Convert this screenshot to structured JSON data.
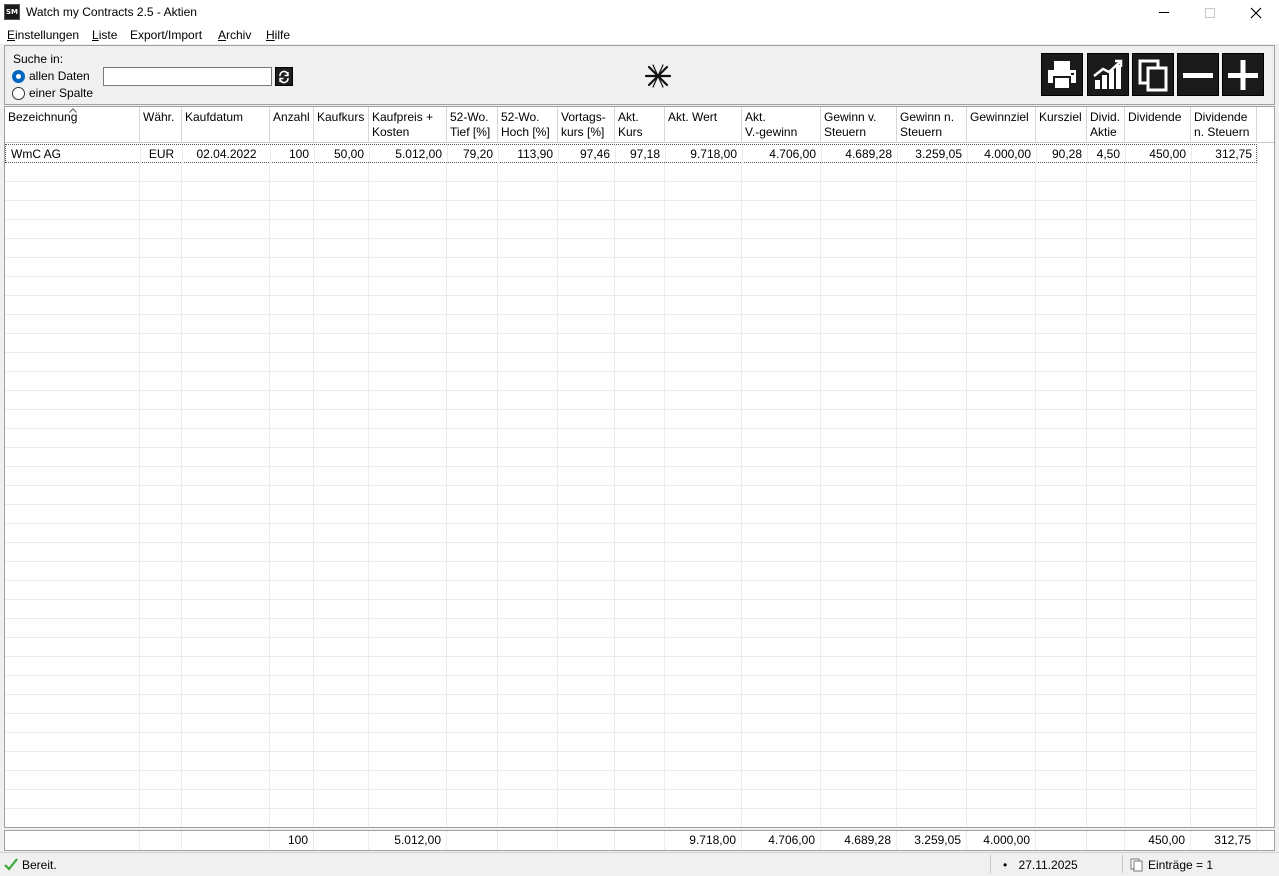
{
  "window": {
    "icon_text": "SM",
    "title": "Watch my Contracts 2.5 - Aktien"
  },
  "menu": [
    {
      "label": "Einstellungen",
      "accel": "E",
      "rest": "instellungen"
    },
    {
      "label": "Liste",
      "accel": "L",
      "rest": "iste"
    },
    {
      "label": "Export/Import",
      "accel": "",
      "rest": "Export/Import"
    },
    {
      "label": "Archiv",
      "accel": "A",
      "rest": "rchiv"
    },
    {
      "label": "Hilfe",
      "accel": "H",
      "rest": "ilfe"
    }
  ],
  "search": {
    "label": "Suche in:",
    "option_all": "allen Daten",
    "option_column": "einer Spalte",
    "selected": "allen Daten",
    "value": "",
    "placeholder": ""
  },
  "toolbar": {
    "buttons": [
      "print-icon",
      "chart-icon",
      "copy-icon",
      "minus-icon",
      "plus-icon"
    ]
  },
  "table": {
    "columns": [
      "Bezeichnung",
      "Währ.",
      "Kaufdatum",
      "Anzahl",
      "Kaufkurs",
      "Kaufpreis +\nKosten",
      "52-Wo.\nTief [%]",
      "52-Wo.\nHoch [%]",
      "Vortags-\nkurs [%]",
      "Akt.\nKurs",
      "Akt. Wert",
      "Akt.\nV.-gewinn",
      "Gewinn v.\nSteuern",
      "Gewinn n.\nSteuern",
      "Gewinnziel",
      "Kursziel",
      "Divid.\nAktie",
      "Dividende",
      "Dividende\nn. Steuern"
    ],
    "sorted_column": "Bezeichnung",
    "rows": [
      [
        "WmC AG",
        "EUR",
        "02.04.2022",
        "100",
        "50,00",
        "5.012,00",
        "79,20",
        "113,90",
        "97,46",
        "97,18",
        "9.718,00",
        "4.706,00",
        "4.689,28",
        "3.259,05",
        "4.000,00",
        "90,28",
        "4,50",
        "450,00",
        "312,75"
      ]
    ],
    "totals": [
      "",
      "",
      "",
      "100",
      "",
      "5.012,00",
      "",
      "",
      "",
      "",
      "9.718,00",
      "4.706,00",
      "4.689,28",
      "3.259,05",
      "4.000,00",
      "",
      "",
      "450,00",
      "312,75"
    ]
  },
  "status": {
    "text": "Bereit.",
    "bullet": "•",
    "date": "27.11.2025",
    "entries": "Einträge = 1"
  },
  "colors": {
    "accent": "#0067c0",
    "toolbar_button": "#1a1a1a",
    "status_ok": "#3aa83a"
  }
}
